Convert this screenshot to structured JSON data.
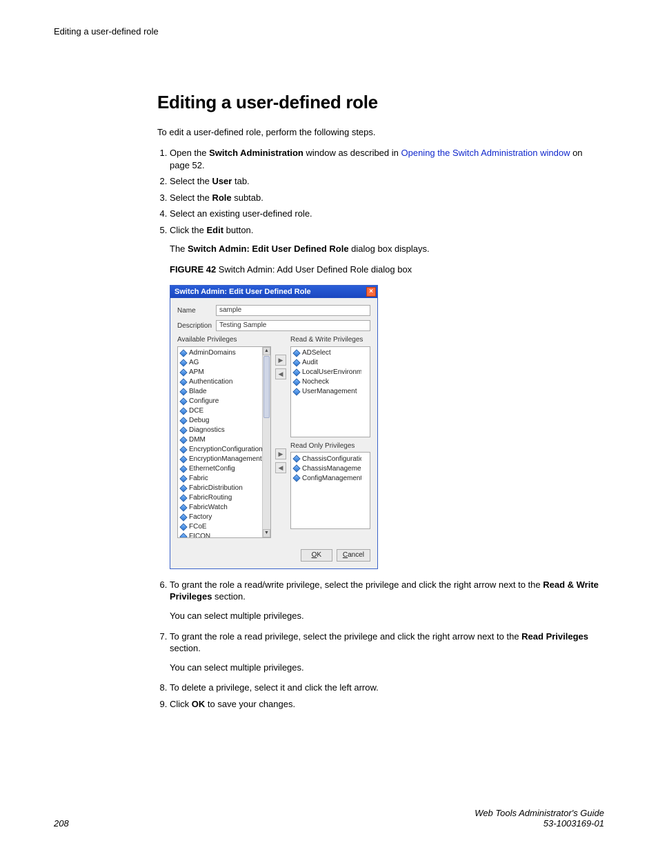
{
  "runningHead": "Editing a user-defined role",
  "title": "Editing a user-defined role",
  "intro": "To edit a user-defined role, perform the following steps.",
  "steps": {
    "s1_a": "Open the ",
    "s1_b": "Switch Administration",
    "s1_c": " window as described in ",
    "s1_link": "Opening the Switch Administration window",
    "s1_d": " on page 52.",
    "s2_a": "Select the ",
    "s2_b": "User",
    "s2_c": " tab.",
    "s3_a": "Select the ",
    "s3_b": "Role",
    "s3_c": " subtab.",
    "s4": "Select an existing user-defined role.",
    "s5_a": "Click the ",
    "s5_b": "Edit",
    "s5_c": " button.",
    "s5_sub_a": "The ",
    "s5_sub_b": "Switch Admin: Edit User Defined Role",
    "s5_sub_c": " dialog box displays.",
    "figcap_a": "FIGURE 42",
    "figcap_b": " Switch Admin: Add User Defined Role dialog box",
    "s6_a": "To grant the role a read/write privilege, select the privilege and click the right arrow next to the ",
    "s6_b": "Read & Write Privileges",
    "s6_c": " section.",
    "s6_sub": "You can select multiple privileges.",
    "s7_a": "To grant the role a read privilege, select the privilege and click the right arrow next to the ",
    "s7_b": "Read Privileges",
    "s7_c": " section.",
    "s7_sub": "You can select multiple privileges.",
    "s8": "To delete a privilege, select it and click the left arrow.",
    "s9_a": "Click ",
    "s9_b": "OK",
    "s9_c": " to save your changes."
  },
  "dialog": {
    "title": "Switch Admin: Edit User Defined Role",
    "nameLabel": "Name",
    "nameValue": "sample",
    "descLabel": "Description",
    "descValue": "Testing Sample",
    "availLabel": "Available Privileges",
    "rwLabel": "Read & Write Privileges",
    "roLabel": "Read Only Privileges",
    "avail": [
      "AdminDomains",
      "AG",
      "APM",
      "Authentication",
      "Blade",
      "Configure",
      "DCE",
      "Debug",
      "Diagnostics",
      "DMM",
      "EncryptionConfiguration",
      "EncryptionManagement",
      "EthernetConfig",
      "Fabric",
      "FabricDistribution",
      "FabricRouting",
      "FabricWatch",
      "Factory",
      "FCoE",
      "FICON"
    ],
    "rw": [
      "ADSelect",
      "Audit",
      "LocalUserEnvironment",
      "Nocheck",
      "UserManagement"
    ],
    "ro": [
      "ChassisConfiguration",
      "ChassisManagement",
      "ConfigManagement"
    ],
    "ok_u": "O",
    "ok_r": "K",
    "cancel_u": "C",
    "cancel_r": "ancel"
  },
  "footer": {
    "page": "208",
    "guide": "Web Tools Administrator's Guide",
    "docnum": "53-1003169-01"
  }
}
